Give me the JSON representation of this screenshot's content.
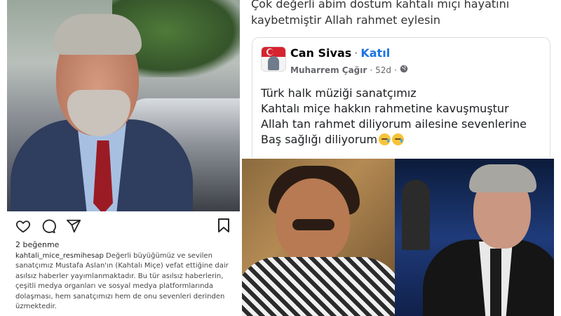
{
  "instagram": {
    "likes": "2 beğenme",
    "username": "kahtali_mice_resmihesap",
    "caption": "Değerli büyüğümüz ve sevilen sanatçımız Mustafa Aslan'ın (Kahtalı Miçe) vefat ettiğine dair asılsız haberler yayımlanmaktadır. Bu tür asılsız haberlerin, çeşitli medya organları ve sosyal medya platformlarında dolaşması, hem sanatçımızı hem de onu sevenleri derinden üzmektedir.",
    "icons": [
      "heart-icon",
      "comment-icon",
      "share-icon",
      "bookmark-icon"
    ]
  },
  "facebook": {
    "headline_line1": "Çok değerli abim dostum kahtalı mıçı hayatını",
    "headline_line2": "kaybetmiştir Allah rahmet eylesin",
    "group_name": "Can Sivas",
    "separator": "·",
    "join_label": "Katıl",
    "author": "Muharrem Çağır",
    "time": "52d",
    "meta_separator": "·",
    "post_lines": [
      "Türk halk müziği sanatçımız",
      "Kahtalı miçe hakkın rahmetine kavuşmuştur",
      "Allah tan rahmet diliyorum ailesine sevenlerine",
      "Baş sağlığı diliyorum"
    ],
    "colors": {
      "join": "#1b74e4",
      "secondary_text": "#65676b"
    }
  }
}
